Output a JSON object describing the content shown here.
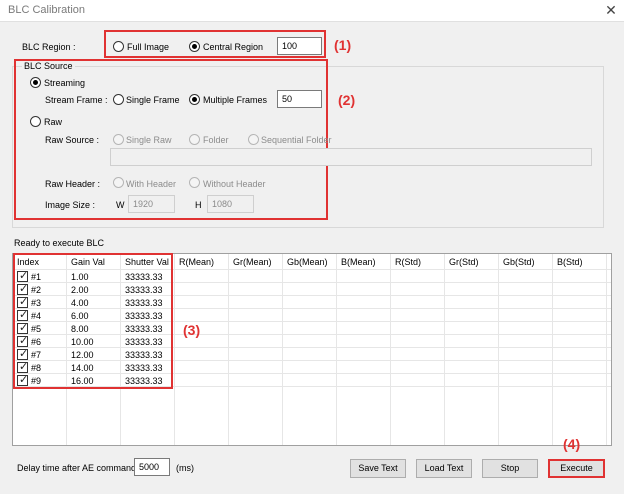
{
  "window": {
    "title": "BLC Calibration",
    "close_glyph": "✕"
  },
  "blc_region": {
    "label": "BLC Region :",
    "options": [
      "Full Image",
      "Central Region"
    ],
    "selected": "Central Region",
    "value": "100"
  },
  "blc_source": {
    "title": "BLC Source",
    "streaming_label": "Streaming",
    "raw_label": "Raw",
    "selected": "Streaming",
    "stream_frame": {
      "label": "Stream Frame :",
      "options": [
        "Single Frame",
        "Multiple Frames"
      ],
      "selected": "Multiple Frames",
      "value": "50"
    },
    "raw_source": {
      "label": "Raw Source :",
      "options": [
        "Single Raw",
        "Folder",
        "Sequential Folder"
      ],
      "path": ""
    },
    "raw_header": {
      "label": "Raw Header :",
      "options": [
        "With Header",
        "Without Header"
      ]
    },
    "image_size": {
      "label": "Image Size :",
      "w_label": "W",
      "w_value": "1920",
      "h_label": "H",
      "h_value": "1080"
    }
  },
  "status": "Ready to execute BLC",
  "table": {
    "columns": [
      "Index",
      "Gain Val",
      "Shutter Val",
      "R(Mean)",
      "Gr(Mean)",
      "Gb(Mean)",
      "B(Mean)",
      "R(Std)",
      "Gr(Std)",
      "Gb(Std)",
      "B(Std)"
    ],
    "rows": [
      {
        "index": "#1",
        "gain": "1.00",
        "shutter": "33333.33",
        "checked": true
      },
      {
        "index": "#2",
        "gain": "2.00",
        "shutter": "33333.33",
        "checked": true
      },
      {
        "index": "#3",
        "gain": "4.00",
        "shutter": "33333.33",
        "checked": true
      },
      {
        "index": "#4",
        "gain": "6.00",
        "shutter": "33333.33",
        "checked": true
      },
      {
        "index": "#5",
        "gain": "8.00",
        "shutter": "33333.33",
        "checked": true
      },
      {
        "index": "#6",
        "gain": "10.00",
        "shutter": "33333.33",
        "checked": true
      },
      {
        "index": "#7",
        "gain": "12.00",
        "shutter": "33333.33",
        "checked": true
      },
      {
        "index": "#8",
        "gain": "14.00",
        "shutter": "33333.33",
        "checked": true
      },
      {
        "index": "#9",
        "gain": "16.00",
        "shutter": "33333.33",
        "checked": true
      }
    ]
  },
  "delay": {
    "label": "Delay time after AE command",
    "value": "5000",
    "unit": "(ms)"
  },
  "buttons": {
    "save": "Save Text",
    "load": "Load Text",
    "stop": "Stop",
    "execute": "Execute"
  },
  "annotations": [
    "(1)",
    "(2)",
    "(3)",
    "(4)"
  ],
  "colors": {
    "highlight": "#e03232"
  }
}
